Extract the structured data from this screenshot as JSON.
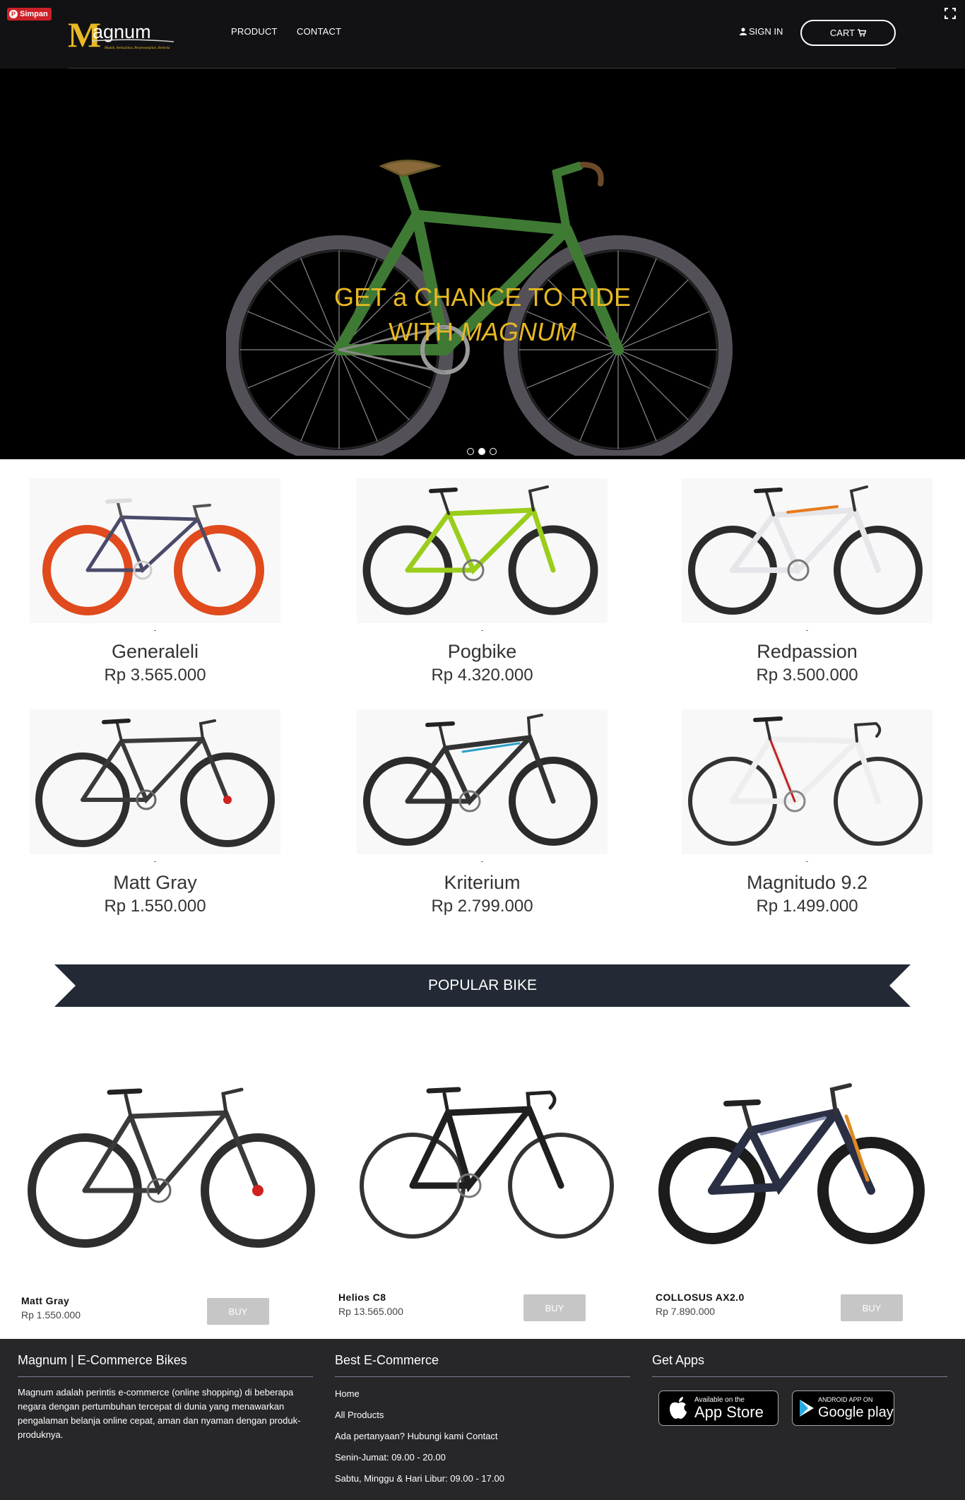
{
  "page": {
    "title": "Magnum | E-Commerce Bikes"
  },
  "pinterest": {
    "label": "Simpan"
  },
  "brand": {
    "name": "agnum",
    "initial": "M",
    "tagline": "Mudah, Berkualitas, Berpenampilan, Berbeda"
  },
  "nav": {
    "links": [
      {
        "label": "PRODUCT"
      },
      {
        "label": "CONTACT"
      }
    ],
    "sign_in": "SIGN IN",
    "cart": "CART"
  },
  "hero": {
    "line1": "GET a CHANCE TO RIDE",
    "line2_prefix": "WITH ",
    "line2_emphasis": "MAGNUM",
    "slides": 3,
    "active_slide": 2
  },
  "products": [
    {
      "name": "Generaleli",
      "price": "Rp 3.565.000"
    },
    {
      "name": "Pogbike",
      "price": "Rp 4.320.000"
    },
    {
      "name": "Redpassion",
      "price": "Rp 3.500.000"
    },
    {
      "name": "Matt Gray",
      "price": "Rp 1.550.000"
    },
    {
      "name": "Kriterium",
      "price": "Rp 2.799.000"
    },
    {
      "name": "Magnitudo 9.2",
      "price": "Rp 1.499.000"
    }
  ],
  "popular": {
    "title": "POPULAR BIKE",
    "items": [
      {
        "name": "Matt Gray",
        "price": "Rp 1.550.000",
        "buy_label": "BUY"
      },
      {
        "name": "Helios C8",
        "price": "Rp 13.565.000",
        "buy_label": "BUY"
      },
      {
        "name": "COLLOSUS AX2.0",
        "price": "Rp 7.890.000",
        "buy_label": "BUY"
      }
    ]
  },
  "footer": {
    "about_title": "Magnum | E-Commerce Bikes",
    "about_text": "Magnum adalah perintis e-commerce (online shopping) di beberapa negara dengan pertumbuhan tercepat di dunia yang menawarkan pengalaman belanja online cepat, aman dan nyaman dengan produk-produknya.",
    "links_title": "Best E-Commerce",
    "links": [
      {
        "label": "Home"
      },
      {
        "label": "All Products"
      },
      {
        "label": "Ada pertanyaan? Hubungi kami Contact"
      },
      {
        "label": "Senin-Jumat: 09.00 - 20.00"
      },
      {
        "label": "Sabtu, Minggu & Hari Libur: 09.00 - 17.00"
      }
    ],
    "apps_title": "Get Apps",
    "appstore": {
      "small": "Available on the",
      "big": "App Store"
    },
    "googleplay": {
      "small": "ANDROID APP ON",
      "big": "Google play"
    }
  },
  "colors": {
    "navbar_bg": "#121214",
    "hero_accent": "#e8b923",
    "banner_bg": "#232a36",
    "footer_bg": "#27272a",
    "buy_button": "#c6c6c6",
    "pinterest_red": "#cb2027"
  }
}
